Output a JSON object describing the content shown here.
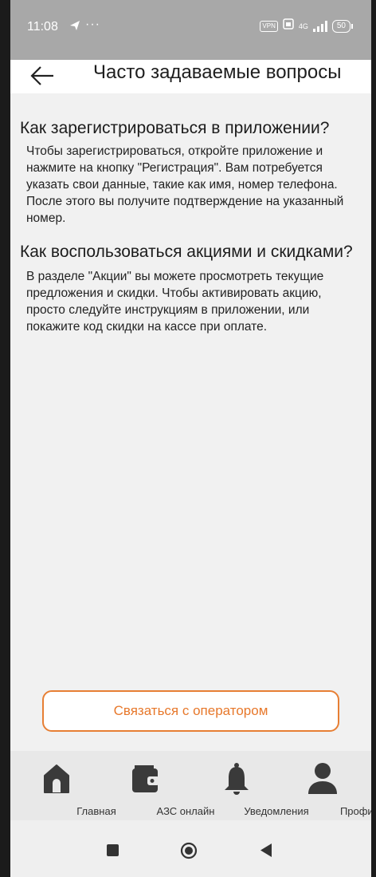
{
  "status_bar": {
    "time": "11:08",
    "send_icon": "send-icon",
    "dots": "···",
    "vpn": "VPN",
    "network": "4G",
    "battery": "50"
  },
  "header": {
    "title": "Часто задаваемые вопросы",
    "back_icon": "back-arrow-icon"
  },
  "faq": [
    {
      "question": "Как зарегистрироваться в приложении?",
      "answer_lines": [
        "Чтобы зарегистрироваться, откройте приложение и",
        "нажмите на кнопку \"Регистрация\". Вам потребуется",
        "указать свои данные, такие как имя, номер телефона.",
        "После этого вы получите подтверждение на указанный",
        "номер."
      ]
    },
    {
      "question": "Как воспользоваться акциями и скидками?",
      "answer_lines": [
        "В разделе \"Акции\" вы можете просмотреть текущие",
        "предложения и скидки. Чтобы активировать акцию,",
        "просто следуйте инструкциям в приложении, или",
        "покажите код скидки на кассе при оплате."
      ]
    }
  ],
  "contact_button": "Связаться с оператором",
  "tabs": [
    {
      "label": "Главная",
      "icon": "home-icon"
    },
    {
      "label": "АЗС онлайн",
      "icon": "wallet-icon"
    },
    {
      "label": "Уведомления",
      "icon": "bell-icon"
    },
    {
      "label": "Профиль",
      "icon": "profile-icon"
    }
  ],
  "colors": {
    "accent": "#e7782b",
    "status_bar": "#a8a8a8",
    "content_bg": "#f1f1f1",
    "tab_bg": "#e8e8e8",
    "icon_dark": "#3a3a3a"
  }
}
